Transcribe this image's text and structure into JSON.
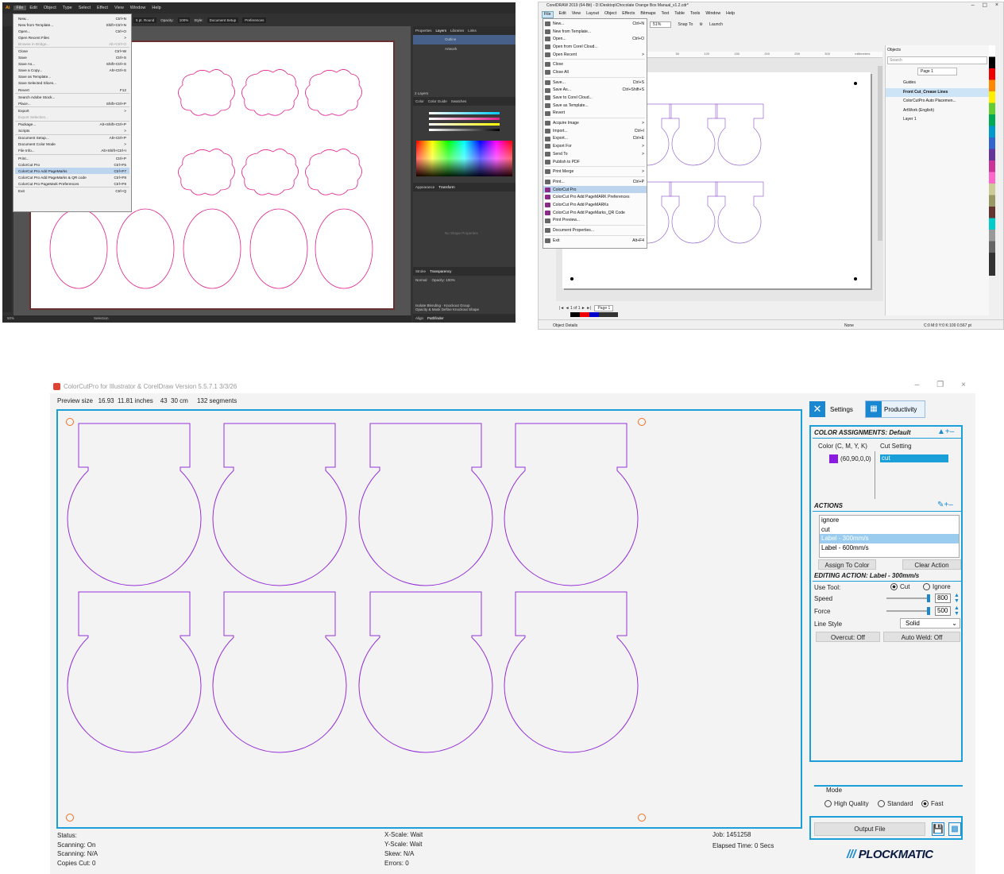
{
  "illustrator": {
    "menubar": [
      "Ai",
      "File",
      "Edit",
      "Object",
      "Type",
      "Select",
      "Effect",
      "View",
      "Window",
      "Help"
    ],
    "control_bar": [
      "5 pt. Round",
      "Opacity:",
      "100%",
      "Style:",
      "Document Setup",
      "Preferences"
    ],
    "menu_items": [
      {
        "label": "New...",
        "shortcut": "Ctrl+N"
      },
      {
        "label": "New from Template...",
        "shortcut": "Shift+Ctrl+N"
      },
      {
        "label": "Open...",
        "shortcut": "Ctrl+O"
      },
      {
        "label": "Open Recent Files",
        "shortcut": ">"
      },
      {
        "label": "Browse in Bridge...",
        "shortcut": "Alt+Ctrl+O",
        "disabled": true
      },
      {
        "sep": true
      },
      {
        "label": "Close",
        "shortcut": "Ctrl+W"
      },
      {
        "label": "Save",
        "shortcut": "Ctrl+S"
      },
      {
        "label": "Save As...",
        "shortcut": "Shift+Ctrl+S"
      },
      {
        "label": "Save a Copy...",
        "shortcut": "Alt+Ctrl+S"
      },
      {
        "label": "Save as Template...",
        "shortcut": ""
      },
      {
        "label": "Save Selected Slices...",
        "shortcut": ""
      },
      {
        "label": "Revert",
        "shortcut": "F12"
      },
      {
        "sep": true
      },
      {
        "label": "Search Adobe Stock...",
        "shortcut": ""
      },
      {
        "label": "Place...",
        "shortcut": "Shift+Ctrl+P"
      },
      {
        "sep": true
      },
      {
        "label": "Export",
        "shortcut": ">"
      },
      {
        "label": "Export Selection...",
        "shortcut": "",
        "disabled": true
      },
      {
        "sep": true
      },
      {
        "label": "Package...",
        "shortcut": "Alt+Shift+Ctrl+P"
      },
      {
        "label": "Scripts",
        "shortcut": ">"
      },
      {
        "sep": true
      },
      {
        "label": "Document Setup...",
        "shortcut": "Alt+Ctrl+P"
      },
      {
        "label": "Document Color Mode",
        "shortcut": ">"
      },
      {
        "label": "File Info...",
        "shortcut": "Alt+Shift+Ctrl+I"
      },
      {
        "sep": true
      },
      {
        "label": "Print...",
        "shortcut": "Ctrl+P"
      },
      {
        "label": "ColorCut Pro",
        "shortcut": "Ctrl+F5"
      },
      {
        "label": "ColorCut Pro Add PageMarks",
        "shortcut": "Ctrl+F7",
        "highlight": true
      },
      {
        "label": "ColorCut Pro Add PageMarks & QR code",
        "shortcut": "Ctrl+F8"
      },
      {
        "label": "ColorCut Pro PageMark Preferences",
        "shortcut": "Ctrl+F9"
      },
      {
        "sep": true
      },
      {
        "label": "Exit",
        "shortcut": "Ctrl+Q"
      }
    ],
    "panel_tabs": [
      "Properties",
      "Layers",
      "Libraries",
      "Links"
    ],
    "layers": [
      "Outline",
      "Artwork"
    ],
    "layers_count": "2 Layers",
    "color_tabs": [
      "Color",
      "Color Guide",
      "Swatches"
    ],
    "appearance_tabs": [
      "Appearance",
      "Transform"
    ],
    "no_shape": "No Shape Properties",
    "transparency_tabs": [
      "Stroke",
      "Transparency"
    ],
    "blend": "Normal",
    "opacity": "Opacity: 100%",
    "transparency_opts": [
      "Isolate Blending",
      "Knockout Group",
      "Opacity & Mask Define Knockout Shape"
    ],
    "bottom_tabs": [
      "Align",
      "Pathfinder"
    ],
    "status": [
      "50%",
      "Selection"
    ]
  },
  "corel": {
    "title": "CorelDRAW 2019 (64-Bit) - D:\\Desktop\\Chocolate Orange Box Manual_v1.2.cdr*",
    "menubar": [
      "File",
      "Edit",
      "View",
      "Layout",
      "Object",
      "Effects",
      "Bitmaps",
      "Text",
      "Table",
      "Tools",
      "Window",
      "Help"
    ],
    "zoom": "51%",
    "snap_to": "Snap To",
    "launch": "Launch",
    "menu_items": [
      {
        "label": "New...",
        "shortcut": "Ctrl+N"
      },
      {
        "label": "New from Template...",
        "shortcut": ""
      },
      {
        "label": "Open...",
        "shortcut": "Ctrl+O"
      },
      {
        "label": "Open from Corel Cloud...",
        "shortcut": ""
      },
      {
        "label": "Open Recent",
        "shortcut": ">"
      },
      {
        "sep": true
      },
      {
        "label": "Close",
        "shortcut": ""
      },
      {
        "label": "Close All",
        "shortcut": ""
      },
      {
        "sep": true
      },
      {
        "label": "Save...",
        "shortcut": "Ctrl+S"
      },
      {
        "label": "Save As...",
        "shortcut": "Ctrl+Shift+S"
      },
      {
        "label": "Save to Corel Cloud...",
        "shortcut": ""
      },
      {
        "label": "Save as Template...",
        "shortcut": ""
      },
      {
        "label": "Revert",
        "shortcut": ""
      },
      {
        "sep": true
      },
      {
        "label": "Acquire Image",
        "shortcut": ">"
      },
      {
        "label": "Import...",
        "shortcut": "Ctrl+I"
      },
      {
        "label": "Export...",
        "shortcut": "Ctrl+E"
      },
      {
        "label": "Export For",
        "shortcut": ">"
      },
      {
        "label": "Send To",
        "shortcut": ">"
      },
      {
        "label": "Publish to PDF",
        "shortcut": ""
      },
      {
        "sep": true
      },
      {
        "label": "Print Merge",
        "shortcut": ">"
      },
      {
        "sep": true
      },
      {
        "label": "Print...",
        "shortcut": "Ctrl+P"
      },
      {
        "label": "ColorCut Pro",
        "shortcut": "",
        "highlight": true,
        "cc": true
      },
      {
        "label": "ColorCut Pro Add PageMARK Preferences",
        "shortcut": "",
        "cc": true
      },
      {
        "label": "ColorCut Pro Add PageMARKs",
        "shortcut": "",
        "cc": true
      },
      {
        "label": "ColorCut Pro Add PageMarks_QR Code",
        "shortcut": "",
        "cc": true
      },
      {
        "label": "Print Preview...",
        "shortcut": ""
      },
      {
        "sep": true
      },
      {
        "label": "Document Properties...",
        "shortcut": ""
      },
      {
        "sep": true
      },
      {
        "label": "Exit",
        "shortcut": "Alt+F4"
      }
    ],
    "objects_panel": {
      "title": "Objects",
      "search": "Search",
      "page": "Page 1",
      "layers": [
        "Guides",
        "Front Cut_Crease Lines",
        "ColorCutPro Auto Placemen...",
        "ArtWork (English)",
        "Layer 1"
      ]
    },
    "ruler": [
      "50",
      "100",
      "150",
      "200",
      "250",
      "300",
      "millimeters"
    ],
    "page_tab": "Page 1",
    "status_left": "Object Details",
    "status_fill": "None",
    "status_outline": "C:0 M:0 Y:0 K:100  0.567 pt"
  },
  "colorcut": {
    "title": "ColorCutPro for Illustrator & CorelDraw Version 5.5.7.1 3/3/26",
    "preview_info": "Preview size   16.93  11.81 inches    43  30 cm     132 segments",
    "settings_label": "Settings",
    "productivity_label": "Productivity",
    "color_assignments_title": "COLOR ASSIGNMENTS: Default",
    "col_color": "Color (C, M, Y, K)",
    "col_cut": "Cut Setting",
    "assignment": {
      "color": "(60,90,0,0)",
      "swatch": "#8a1be0",
      "setting": "cut"
    },
    "actions_title": "ACTIONS",
    "actions": [
      "ignore",
      "cut",
      "Label - 300mm/s",
      "Label - 600mm/s"
    ],
    "selected_action": 2,
    "assign_btn": "Assign To Color",
    "clear_btn": "Clear Action",
    "editing_title": "EDITING ACTION: Label - 300mm/s",
    "use_tool": "Use Tool:",
    "tool_cut": "Cut",
    "tool_ignore": "Ignore",
    "speed_label": "Speed",
    "speed": "800",
    "force_label": "Force",
    "force": "500",
    "linestyle_label": "Line Style",
    "linestyle": "Solid",
    "overcut": "Overcut: Off",
    "autoweld": "Auto Weld: Off",
    "mode_title": "Mode",
    "mode_hq": "High Quality",
    "mode_std": "Standard",
    "mode_fast": "Fast",
    "output_btn": "Output File",
    "brand": "PLOCKMATIC",
    "status": {
      "status": "Status:",
      "scanning_on": "Scanning: On",
      "scanning_na": "Scanning:  N/A",
      "copies": "Copies Cut: 0",
      "xscale": "X-Scale: Wait",
      "yscale": "Y-Scale: Wait",
      "skew": "Skew:  N/A",
      "errors": "Errors: 0",
      "job": "Job: 1451258",
      "elapsed": "Elapsed Time:  0 Secs"
    },
    "shape_color": "#9430d8",
    "accent": "#1a9fd8"
  }
}
